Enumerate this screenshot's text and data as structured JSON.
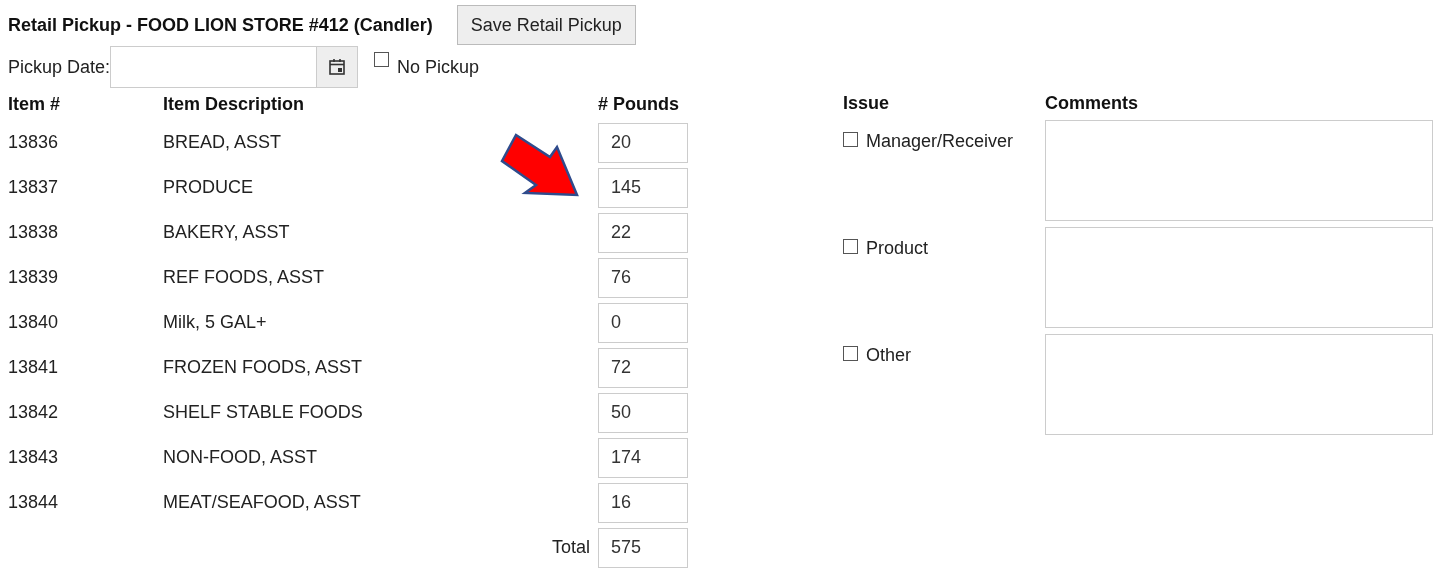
{
  "title": "Retail Pickup - FOOD LION STORE #412 (Candler)",
  "save_button": "Save Retail Pickup",
  "pickup_date": {
    "label": "Pickup Date:"
  },
  "no_pickup": {
    "label": "No Pickup",
    "checked": false
  },
  "items_table": {
    "columns": [
      "Item #",
      "Item Description",
      "# Pounds"
    ],
    "rows": [
      {
        "item": "13836",
        "description": "BREAD, ASST",
        "pounds": "20"
      },
      {
        "item": "13837",
        "description": "PRODUCE",
        "pounds": "145"
      },
      {
        "item": "13838",
        "description": "BAKERY, ASST",
        "pounds": "22"
      },
      {
        "item": "13839",
        "description": "REF FOODS, ASST",
        "pounds": "76"
      },
      {
        "item": "13840",
        "description": "Milk, 5 GAL+",
        "pounds": "0"
      },
      {
        "item": "13841",
        "description": "FROZEN FOODS, ASST",
        "pounds": "72"
      },
      {
        "item": "13842",
        "description": "SHELF STABLE FOODS",
        "pounds": "50"
      },
      {
        "item": "13843",
        "description": "NON-FOOD, ASST",
        "pounds": "174"
      },
      {
        "item": "13844",
        "description": "MEAT/SEAFOOD, ASST",
        "pounds": "16"
      }
    ],
    "total": {
      "label": "Total",
      "value": "575"
    }
  },
  "issues": {
    "columns": [
      "Issue",
      "Comments"
    ],
    "rows": [
      {
        "label": "Manager/Receiver",
        "checked": false
      },
      {
        "label": "Product",
        "checked": false
      },
      {
        "label": "Other",
        "checked": false
      }
    ]
  }
}
